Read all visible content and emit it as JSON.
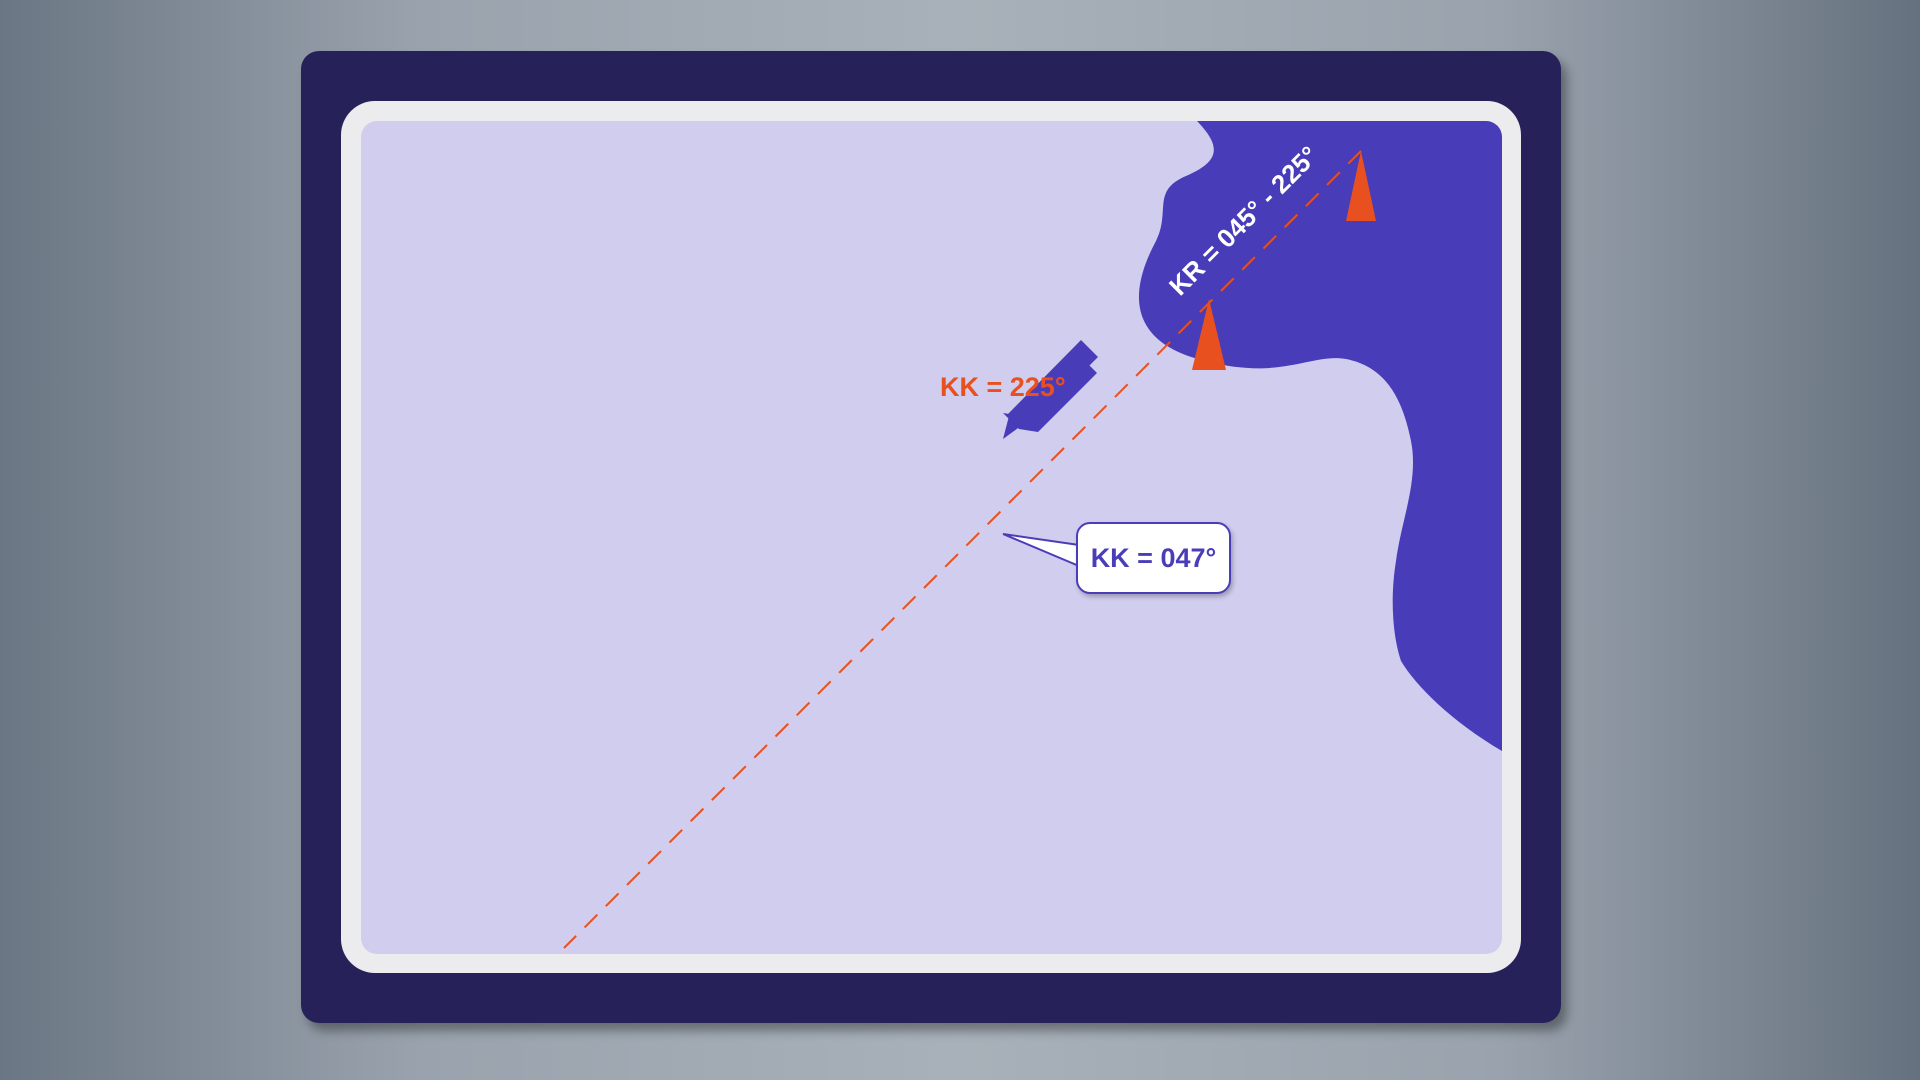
{
  "diagram": {
    "course_label": "KK = 225°",
    "callout_label": "KK = 047°",
    "leading_line_label": "KR = 045° - 225°",
    "colors": {
      "land": "#493cb9",
      "water": "#d1cdee",
      "marker": "#e8501f",
      "boat": "#493cb9",
      "frame": "#27215a"
    },
    "icons": [
      "boat-icon",
      "leading-mark-front-icon",
      "leading-mark-rear-icon"
    ]
  }
}
